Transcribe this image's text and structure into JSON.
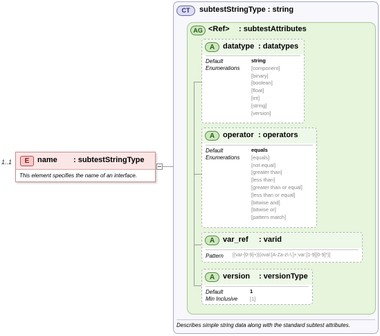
{
  "element": {
    "cardinality": "1..1",
    "badge": "E",
    "name": "name",
    "type": ": subtestStringType",
    "doc": "This element specifies the name of an interface."
  },
  "complex_type": {
    "badge": "CT",
    "title": "subtestStringType : string",
    "doc": "Describes simple string data along with the standard subtest attributes."
  },
  "attribute_group": {
    "badge": "AG",
    "ref": "<Ref>",
    "name": ": subtestAttributes"
  },
  "attributes": {
    "datatype": {
      "badge": "A",
      "name": "datatype",
      "type": ": datatypes",
      "label_default": "Default",
      "label_enum": "Enumerations",
      "default": "string",
      "enums": [
        "[component]",
        "[binary]",
        "[boolean]",
        "[float]",
        "[int]",
        "[string]",
        "[version]"
      ]
    },
    "operator": {
      "badge": "A",
      "name": "operator",
      "type": ": operators",
      "label_default": "Default",
      "label_enum": "Enumerations",
      "default": "equals",
      "enums": [
        "[equals]",
        "[not equal]",
        "[greater than]",
        "[less than]",
        "[greater than or equal]",
        "[less than or equal]",
        "[bitwise and]",
        "[bitwise or]",
        "[pattern match]"
      ]
    },
    "var_ref": {
      "badge": "A",
      "name": "var_ref",
      "type": ": varid",
      "label_pattern": "Pattern",
      "pattern": "[(var-[0-9]+)|(oval:[A-Za-z\\-\\.]+:var:[1-9][0-9]*)]"
    },
    "version": {
      "badge": "A",
      "name": "version",
      "type": ": versionType",
      "label_default": "Default",
      "label_min": "Min Inclusive",
      "default": "1",
      "min": "[1]"
    }
  },
  "colors": {
    "element_header": "#fbe6e6",
    "element_border": "#c98a8a",
    "complex_type_bg": "#f7f7fc",
    "attribute_group_bg": "#e6f5dc",
    "attribute_header": "#eef8e8"
  }
}
